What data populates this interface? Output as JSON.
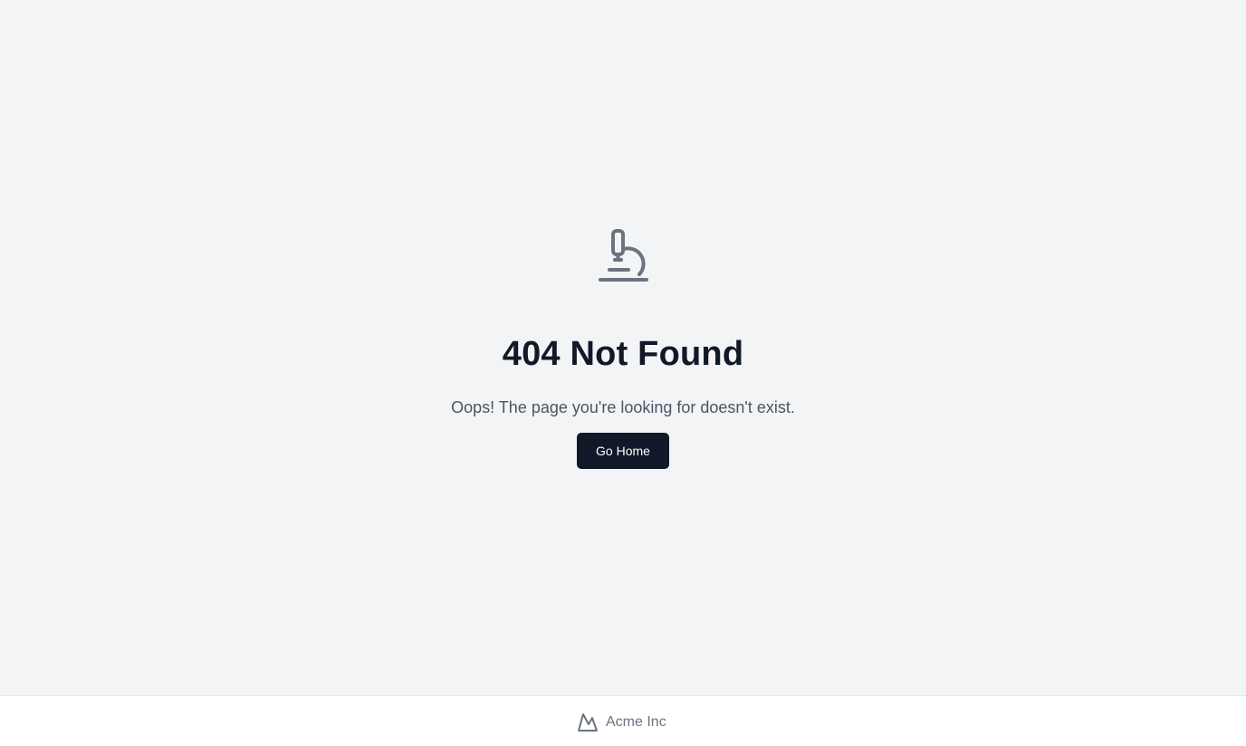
{
  "error": {
    "icon": "microscope-icon",
    "title": "404 Not Found",
    "message": "Oops! The page you're looking for doesn't exist.",
    "home_button_label": "Go Home"
  },
  "footer": {
    "brand_icon": "mountain-icon",
    "brand_name": "Acme Inc"
  },
  "colors": {
    "background": "#f3f4f6",
    "title": "#111827",
    "message": "#4b5563",
    "icon": "#6b7280",
    "button_bg": "#111827",
    "button_text": "#ffffff",
    "footer_bg": "#ffffff",
    "footer_text": "#6b7280"
  }
}
